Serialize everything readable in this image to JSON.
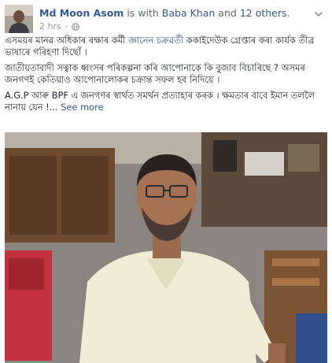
{
  "post": {
    "author": "Md Moon Asom",
    "is_with": "is with",
    "tagged_person": "Baba Khan",
    "and_word": "and",
    "others": "12 others",
    "period": ".",
    "timestamp": "2 hrs",
    "separator": "·",
    "privacy_icon": "globe-icon",
    "options_icon": "chevron-down-icon",
    "paragraph1_before": "এসময়ৰ মানৱ অধিকাৰ ৰক্ষাৰ কৰ্মী ",
    "paragraph1_mention": "জ্ঞানেন চক্ৰৱৰ্তী",
    "paragraph1_after": " ককাইদেউক গ্ৰেপ্তাৰ কৰা কাৰ্যক তীব্ৰ ভাষাৰে গৰিহণা দিছোঁ ।",
    "paragraph2": "জাতীয়তাবাদী সত্বাক ধ্বংসৰ পৰিকল্পনা কৰি আপোনাকে কি বুজাব বিচাৰিছে ? অসমৰ জনগণই কেতিয়াও আপোনালোকৰ চক্ৰান্ত সফল হব নিদিয়ে ।",
    "paragraph3": "A.G.P আৰু BPF এ জনগণৰ স্বাৰ্থত সমৰ্থন প্ৰত্যাহাৰ কৰক । ক্ষমতাৰ বাবে ইমান তললৈ নানায় যেন !...",
    "see_more": "See more",
    "photo_description_icon": "photo-image"
  },
  "colors": {
    "link": "#365899",
    "text": "#1d2129",
    "meta": "#90949c"
  }
}
